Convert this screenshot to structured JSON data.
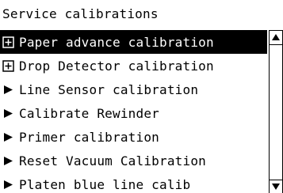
{
  "header": {
    "title": "Service calibrations"
  },
  "menu": {
    "items": [
      {
        "label": "Paper advance calibration",
        "icon": "expand-plus-icon",
        "selected": true
      },
      {
        "label": "Drop Detector calibration",
        "icon": "expand-plus-icon",
        "selected": false
      },
      {
        "label": "Line Sensor calibration",
        "icon": "triangle-right-icon",
        "selected": false
      },
      {
        "label": "Calibrate Rewinder",
        "icon": "triangle-right-icon",
        "selected": false
      },
      {
        "label": "Primer calibration",
        "icon": "triangle-right-icon",
        "selected": false
      },
      {
        "label": "Reset Vacuum Calibration",
        "icon": "triangle-right-icon",
        "selected": false
      },
      {
        "label": "Platen blue line calib",
        "icon": "triangle-right-icon",
        "selected": false
      }
    ]
  },
  "scrollbar": {
    "up_icon": "triangle-up-icon",
    "down_icon": "triangle-down-icon"
  },
  "colors": {
    "background": "#ffffff",
    "text": "#000000",
    "selected_background": "#000000",
    "selected_text": "#ffffff"
  }
}
